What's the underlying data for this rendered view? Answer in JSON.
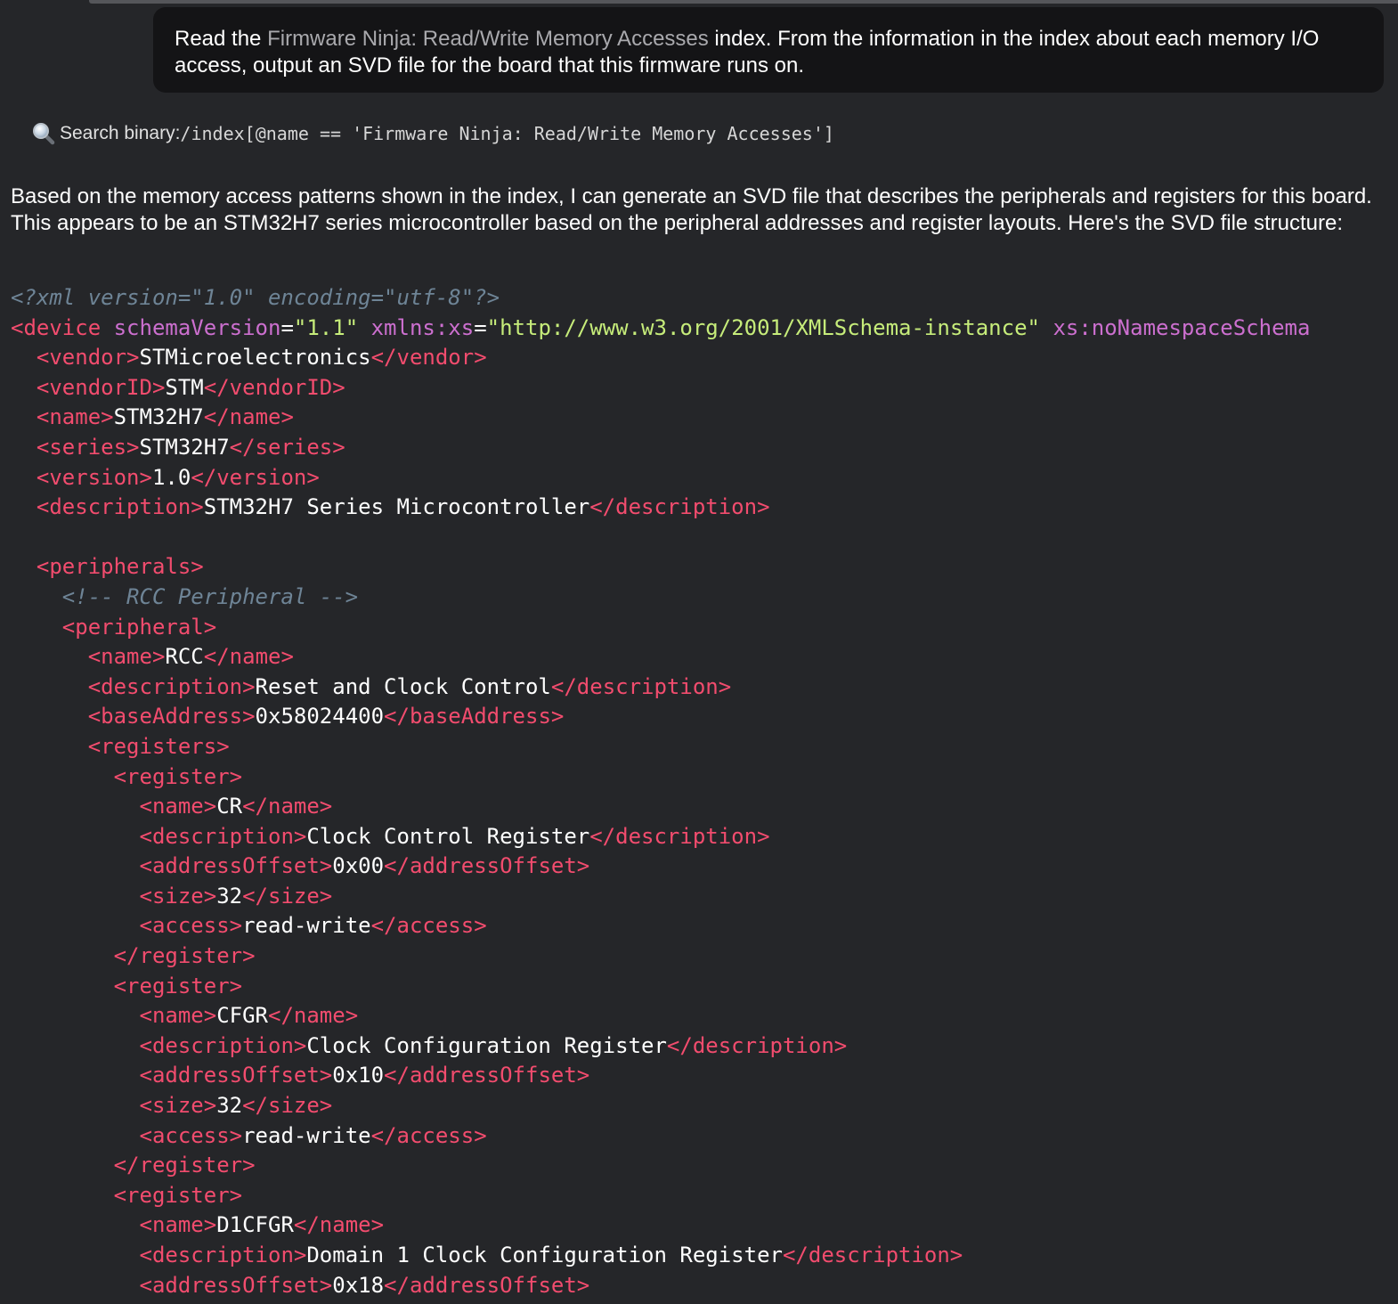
{
  "user_message": {
    "before": "Read the ",
    "index_ref": "Firmware Ninja: Read/Write Memory Accesses",
    "after": " index. From the information in the index about each memory I/O access, output an SVD file for the board that this firmware runs on."
  },
  "tool_call": {
    "icon": "magnifier-icon",
    "label": "Search binary: ",
    "query": "/index[@name == 'Firmware Ninja: Read/Write Memory Accesses']"
  },
  "answer": {
    "text": "Based on the memory access patterns shown in the index, I can generate an SVD file that describes the peripherals and registers for this board. This appears to be an STM32H7 series microcontroller based on the peripheral addresses and register layouts. Here's the SVD file structure:"
  },
  "colors": {
    "background": "#252629",
    "bubble": "#141416",
    "tag": "#f24c6e",
    "attribute": "#cc6fcf",
    "string": "#c6ec7a",
    "comment": "#6e8496"
  },
  "code_lines": [
    [
      [
        "com",
        "<?xml version=\"1.0\" encoding=\"utf-8\"?>"
      ]
    ],
    [
      [
        "tag",
        "<device"
      ],
      [
        "txt",
        " "
      ],
      [
        "attr",
        "schemaVersion"
      ],
      [
        "txt",
        "="
      ],
      [
        "str",
        "\"1.1\""
      ],
      [
        "txt",
        " "
      ],
      [
        "attr",
        "xmlns:xs"
      ],
      [
        "txt",
        "="
      ],
      [
        "str",
        "\"http://www.w3.org/2001/XMLSchema-instance\""
      ],
      [
        "txt",
        " "
      ],
      [
        "attr",
        "xs:noNamespaceSchema"
      ]
    ],
    [
      [
        "txt",
        "  "
      ],
      [
        "tag",
        "<vendor>"
      ],
      [
        "txt",
        "STMicroelectronics"
      ],
      [
        "tag",
        "</vendor>"
      ]
    ],
    [
      [
        "txt",
        "  "
      ],
      [
        "tag",
        "<vendorID>"
      ],
      [
        "txt",
        "STM"
      ],
      [
        "tag",
        "</vendorID>"
      ]
    ],
    [
      [
        "txt",
        "  "
      ],
      [
        "tag",
        "<name>"
      ],
      [
        "txt",
        "STM32H7"
      ],
      [
        "tag",
        "</name>"
      ]
    ],
    [
      [
        "txt",
        "  "
      ],
      [
        "tag",
        "<series>"
      ],
      [
        "txt",
        "STM32H7"
      ],
      [
        "tag",
        "</series>"
      ]
    ],
    [
      [
        "txt",
        "  "
      ],
      [
        "tag",
        "<version>"
      ],
      [
        "txt",
        "1.0"
      ],
      [
        "tag",
        "</version>"
      ]
    ],
    [
      [
        "txt",
        "  "
      ],
      [
        "tag",
        "<description>"
      ],
      [
        "txt",
        "STM32H7 Series Microcontroller"
      ],
      [
        "tag",
        "</description>"
      ]
    ],
    [],
    [
      [
        "txt",
        "  "
      ],
      [
        "tag",
        "<peripherals>"
      ]
    ],
    [
      [
        "txt",
        "    "
      ],
      [
        "com",
        "<!-- RCC Peripheral -->"
      ]
    ],
    [
      [
        "txt",
        "    "
      ],
      [
        "tag",
        "<peripheral>"
      ]
    ],
    [
      [
        "txt",
        "      "
      ],
      [
        "tag",
        "<name>"
      ],
      [
        "txt",
        "RCC"
      ],
      [
        "tag",
        "</name>"
      ]
    ],
    [
      [
        "txt",
        "      "
      ],
      [
        "tag",
        "<description>"
      ],
      [
        "txt",
        "Reset and Clock Control"
      ],
      [
        "tag",
        "</description>"
      ]
    ],
    [
      [
        "txt",
        "      "
      ],
      [
        "tag",
        "<baseAddress>"
      ],
      [
        "txt",
        "0x58024400"
      ],
      [
        "tag",
        "</baseAddress>"
      ]
    ],
    [
      [
        "txt",
        "      "
      ],
      [
        "tag",
        "<registers>"
      ]
    ],
    [
      [
        "txt",
        "        "
      ],
      [
        "tag",
        "<register>"
      ]
    ],
    [
      [
        "txt",
        "          "
      ],
      [
        "tag",
        "<name>"
      ],
      [
        "txt",
        "CR"
      ],
      [
        "tag",
        "</name>"
      ]
    ],
    [
      [
        "txt",
        "          "
      ],
      [
        "tag",
        "<description>"
      ],
      [
        "txt",
        "Clock Control Register"
      ],
      [
        "tag",
        "</description>"
      ]
    ],
    [
      [
        "txt",
        "          "
      ],
      [
        "tag",
        "<addressOffset>"
      ],
      [
        "txt",
        "0x00"
      ],
      [
        "tag",
        "</addressOffset>"
      ]
    ],
    [
      [
        "txt",
        "          "
      ],
      [
        "tag",
        "<size>"
      ],
      [
        "txt",
        "32"
      ],
      [
        "tag",
        "</size>"
      ]
    ],
    [
      [
        "txt",
        "          "
      ],
      [
        "tag",
        "<access>"
      ],
      [
        "txt",
        "read-write"
      ],
      [
        "tag",
        "</access>"
      ]
    ],
    [
      [
        "txt",
        "        "
      ],
      [
        "tag",
        "</register>"
      ]
    ],
    [
      [
        "txt",
        "        "
      ],
      [
        "tag",
        "<register>"
      ]
    ],
    [
      [
        "txt",
        "          "
      ],
      [
        "tag",
        "<name>"
      ],
      [
        "txt",
        "CFGR"
      ],
      [
        "tag",
        "</name>"
      ]
    ],
    [
      [
        "txt",
        "          "
      ],
      [
        "tag",
        "<description>"
      ],
      [
        "txt",
        "Clock Configuration Register"
      ],
      [
        "tag",
        "</description>"
      ]
    ],
    [
      [
        "txt",
        "          "
      ],
      [
        "tag",
        "<addressOffset>"
      ],
      [
        "txt",
        "0x10"
      ],
      [
        "tag",
        "</addressOffset>"
      ]
    ],
    [
      [
        "txt",
        "          "
      ],
      [
        "tag",
        "<size>"
      ],
      [
        "txt",
        "32"
      ],
      [
        "tag",
        "</size>"
      ]
    ],
    [
      [
        "txt",
        "          "
      ],
      [
        "tag",
        "<access>"
      ],
      [
        "txt",
        "read-write"
      ],
      [
        "tag",
        "</access>"
      ]
    ],
    [
      [
        "txt",
        "        "
      ],
      [
        "tag",
        "</register>"
      ]
    ],
    [
      [
        "txt",
        "        "
      ],
      [
        "tag",
        "<register>"
      ]
    ],
    [
      [
        "txt",
        "          "
      ],
      [
        "tag",
        "<name>"
      ],
      [
        "txt",
        "D1CFGR"
      ],
      [
        "tag",
        "</name>"
      ]
    ],
    [
      [
        "txt",
        "          "
      ],
      [
        "tag",
        "<description>"
      ],
      [
        "txt",
        "Domain 1 Clock Configuration Register"
      ],
      [
        "tag",
        "</description>"
      ]
    ],
    [
      [
        "txt",
        "          "
      ],
      [
        "tag",
        "<addressOffset>"
      ],
      [
        "txt",
        "0x18"
      ],
      [
        "tag",
        "</addressOffset>"
      ]
    ]
  ]
}
